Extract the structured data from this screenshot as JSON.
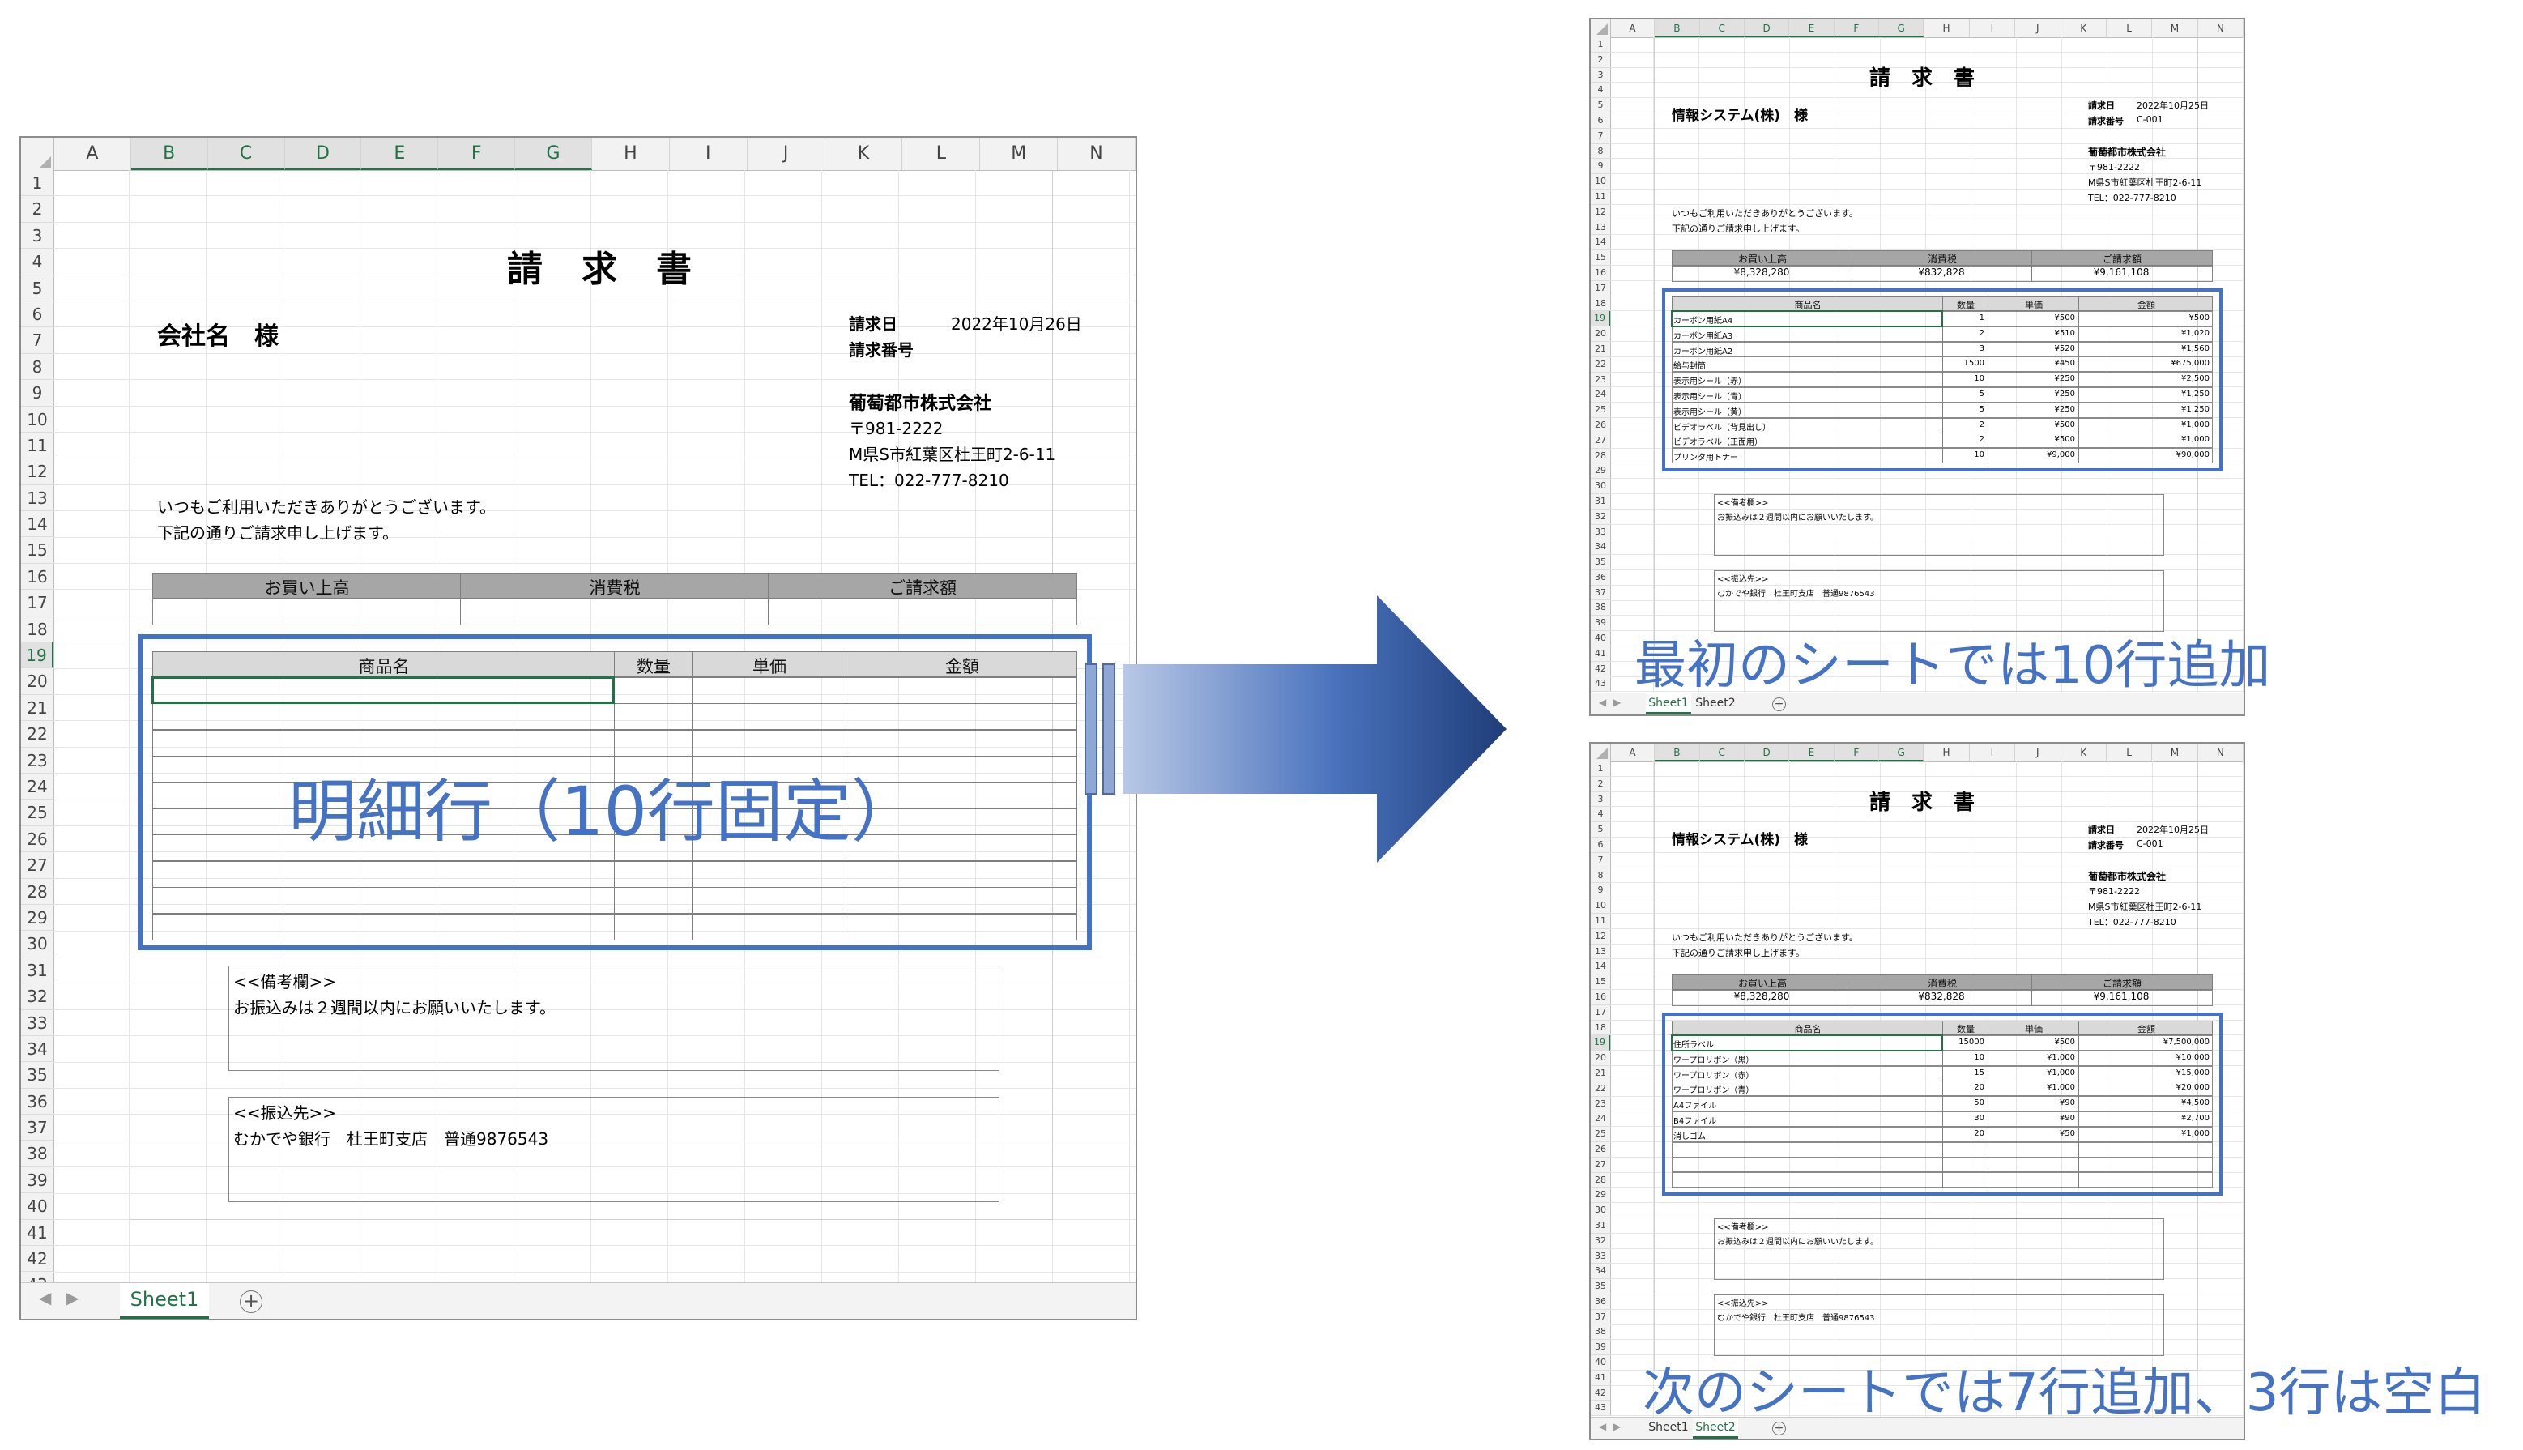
{
  "columns": [
    "A",
    "B",
    "C",
    "D",
    "E",
    "F",
    "G",
    "H",
    "I",
    "J",
    "K",
    "L",
    "M",
    "N"
  ],
  "rows": [
    "1",
    "2",
    "3",
    "4",
    "5",
    "6",
    "7",
    "8",
    "9",
    "10",
    "11",
    "12",
    "13",
    "14",
    "15",
    "16",
    "17",
    "18",
    "19",
    "20",
    "21",
    "22",
    "23",
    "24",
    "25",
    "26",
    "27",
    "28",
    "29",
    "30",
    "31",
    "32",
    "33",
    "34",
    "35",
    "36",
    "37",
    "38",
    "39",
    "40",
    "41",
    "42",
    "43"
  ],
  "invoice": {
    "title": "請　求　書",
    "customer": "会社名　様",
    "date_label": "請求日",
    "date_value": "2022年10月26日",
    "number_label": "請求番号",
    "company": "葡萄都市株式会社",
    "postal": "〒981-2222",
    "address": "M県S市紅葉区杜王町2-6-11",
    "tel": "TEL：022-777-8210",
    "greeting1": "いつもご利用いただきありがとうございます。",
    "greeting2": "下記の通りご請求申し上げます。",
    "summary_headers": [
      "お買い上高",
      "消費税",
      "ご請求額"
    ],
    "detail_headers": [
      "商品名",
      "数量",
      "単価",
      "金額"
    ],
    "remarks_title": "<<備考欄>>",
    "remarks_text": "お振込みは２週間以内にお願いいたします。",
    "bank_title": "<<振込先>>",
    "bank_text": "むかでや銀行　杜王町支店　普通9876543"
  },
  "sheet_tabs": {
    "sheet1": "Sheet1",
    "sheet2": "Sheet2"
  },
  "sheet_b": {
    "customer": "情報システム(株)　様",
    "date_label": "請求日",
    "date_value": "2022年10月25日",
    "number_label": "請求番号",
    "number_value": "C-001",
    "summary_values": [
      "¥8,328,280",
      "¥832,828",
      "¥9,161,108"
    ],
    "items": [
      [
        "カーボン用紙A4",
        "1",
        "¥500",
        "¥500"
      ],
      [
        "カーボン用紙A3",
        "2",
        "¥510",
        "¥1,020"
      ],
      [
        "カーボン用紙A2",
        "3",
        "¥520",
        "¥1,560"
      ],
      [
        "給与封筒",
        "1500",
        "¥450",
        "¥675,000"
      ],
      [
        "表示用シール（赤）",
        "10",
        "¥250",
        "¥2,500"
      ],
      [
        "表示用シール（青）",
        "5",
        "¥250",
        "¥1,250"
      ],
      [
        "表示用シール（黄）",
        "5",
        "¥250",
        "¥1,250"
      ],
      [
        "ビデオラベル（背見出し）",
        "2",
        "¥500",
        "¥1,000"
      ],
      [
        "ビデオラベル（正面用）",
        "2",
        "¥500",
        "¥1,000"
      ],
      [
        "プリンタ用トナー",
        "10",
        "¥9,000",
        "¥90,000"
      ]
    ]
  },
  "sheet_c": {
    "customer": "情報システム(株)　様",
    "date_label": "請求日",
    "date_value": "2022年10月25日",
    "number_label": "請求番号",
    "number_value": "C-001",
    "summary_values": [
      "¥8,328,280",
      "¥832,828",
      "¥9,161,108"
    ],
    "items": [
      [
        "住所ラベル",
        "15000",
        "¥500",
        "¥7,500,000"
      ],
      [
        "ワープロリボン（黒）",
        "10",
        "¥1,000",
        "¥10,000"
      ],
      [
        "ワープロリボン（赤）",
        "15",
        "¥1,000",
        "¥15,000"
      ],
      [
        "ワープロリボン（青）",
        "20",
        "¥1,000",
        "¥20,000"
      ],
      [
        "A4ファイル",
        "50",
        "¥90",
        "¥4,500"
      ],
      [
        "B4ファイル",
        "30",
        "¥90",
        "¥2,700"
      ],
      [
        "消しゴム",
        "20",
        "¥50",
        "¥1,000"
      ],
      [
        "",
        "",
        "",
        ""
      ],
      [
        "",
        "",
        "",
        ""
      ],
      [
        "",
        "",
        "",
        ""
      ]
    ]
  },
  "captions": {
    "main": "明細行（10行固定）",
    "first": "最初のシートでは10行追加",
    "next": "次のシートでは7行追加、3行は空白"
  },
  "colors": {
    "accent": "#4472c4",
    "excel_green": "#217346",
    "header_gray": "#a6a6a6"
  }
}
